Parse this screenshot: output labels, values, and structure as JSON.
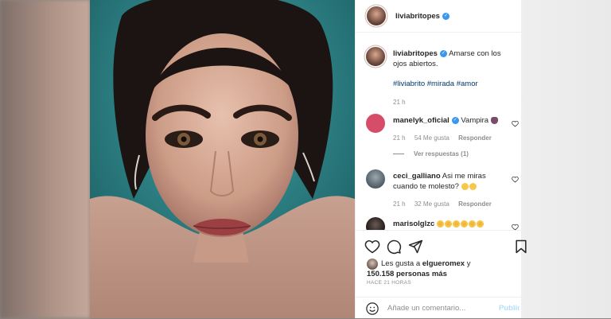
{
  "post": {
    "username": "liviabritopes",
    "verified_mark": "✓"
  },
  "caption": {
    "username": "liviabritopes",
    "text": "Amarse con los ojos abiertos.",
    "hashtags": "#liviabrito #mirada #amor",
    "time": "21 h"
  },
  "comments": [
    {
      "username": "manelyk_oficial",
      "text": "Vampira",
      "emoji": "vampire-emoji",
      "time": "21 h",
      "likes": "54 Me gusta",
      "reply": "Responder",
      "view_replies": "Ver respuestas (1)"
    },
    {
      "username": "ceci_galliano",
      "text": "Asi me miras cuando te molesto?",
      "emoji": "sweat-smile-emoji",
      "time": "21 h",
      "likes": "32 Me gusta",
      "reply": "Responder"
    },
    {
      "username": "marisolglzc",
      "emoji": "star-struck-emoji"
    }
  ],
  "likes": {
    "prefix": "Les gusta a ",
    "user": "elgueromex",
    "middle": " y",
    "count": "150.158 personas más"
  },
  "timestamp": "HACE 21 HORAS",
  "composer": {
    "placeholder": "Añade un comentario...",
    "post_label": "Publicar"
  },
  "icons": {
    "like": "heart-icon",
    "comment": "comment-icon",
    "share": "send-icon",
    "save": "bookmark-icon",
    "emoji": "smiley-icon"
  },
  "colors": {
    "link": "#00376b",
    "verified": "#3897f0",
    "muted": "#8e8e8e",
    "post_button": "#b2dffc"
  }
}
